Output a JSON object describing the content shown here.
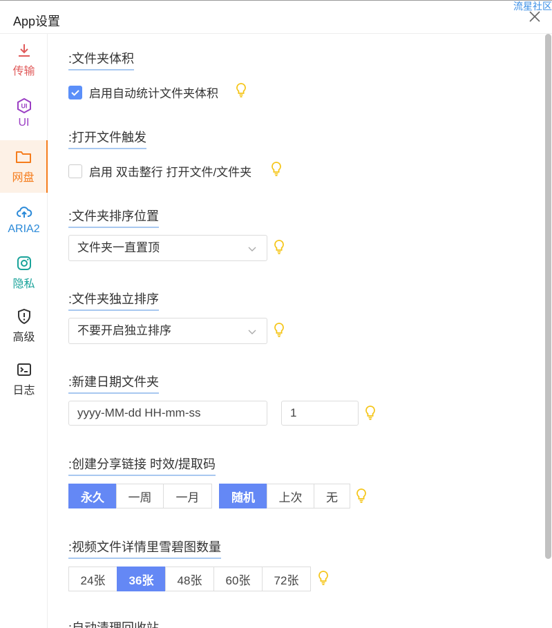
{
  "header": {
    "title": "App设置",
    "corner_link": "流星社区"
  },
  "sidebar": {
    "items": [
      {
        "label": "传输",
        "icon": "download-icon",
        "color": "#e05a5a"
      },
      {
        "label": "UI",
        "icon": "ui-badge-icon",
        "color": "#9b3fc4"
      },
      {
        "label": "网盘",
        "icon": "folder-icon",
        "color": "#f57c1c",
        "active": true
      },
      {
        "label": "ARIA2",
        "icon": "cloud-upload-icon",
        "color": "#2a89d8"
      },
      {
        "label": "隐私",
        "icon": "instagram-icon",
        "color": "#1aa39a"
      },
      {
        "label": "高级",
        "icon": "shield-alert-icon",
        "color": "#333333"
      },
      {
        "label": "日志",
        "icon": "terminal-icon",
        "color": "#333333"
      }
    ]
  },
  "sections": {
    "folder_size": {
      "title": ":文件夹体积",
      "checkbox_label": "启用自动统计文件夹体积",
      "checked": true
    },
    "open_file": {
      "title": ":打开文件触发",
      "checkbox_label": "启用 双击整行 打开文件/文件夹",
      "checked": false
    },
    "folder_sort": {
      "title": ":文件夹排序位置",
      "value": "文件夹一直置顶"
    },
    "independent_sort": {
      "title": ":文件夹独立排序",
      "value": "不要开启独立排序"
    },
    "date_folder": {
      "title": ":新建日期文件夹",
      "format_placeholder": "yyyy-MM-dd HH-mm-ss",
      "count": "1"
    },
    "share_link": {
      "title": ":创建分享链接 时效/提取码",
      "duration": [
        "永久",
        "一周",
        "一月"
      ],
      "duration_selected": 0,
      "code": [
        "随机",
        "上次",
        "无"
      ],
      "code_selected": 0
    },
    "thumbs": {
      "title": ":视频文件详情里雪碧图数量",
      "options": [
        "24张",
        "36张",
        "48张",
        "60张",
        "72张"
      ],
      "selected": 1
    },
    "recycle": {
      "title": ":自动清理回收站"
    }
  },
  "colors": {
    "accent": "#6488f5",
    "bulb": "#f5c518",
    "underline": "#a8c8f0"
  }
}
